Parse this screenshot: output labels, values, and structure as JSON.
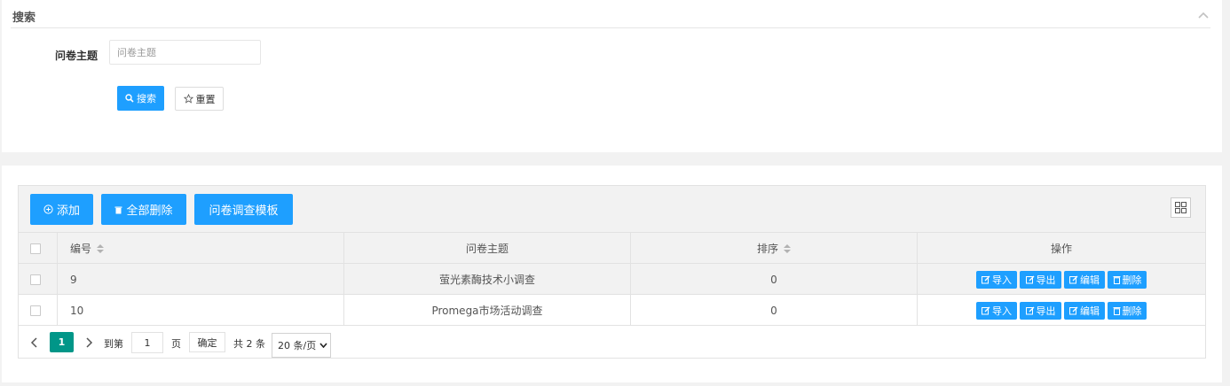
{
  "search": {
    "title": "搜索",
    "field_label": "问卷主题",
    "input_placeholder": "问卷主题",
    "input_value": "",
    "search_label": "搜索",
    "reset_label": "重置"
  },
  "toolbar": {
    "add_label": "添加",
    "delete_all_label": "全部删除",
    "template_label": "问卷调查模板"
  },
  "table": {
    "headers": {
      "id": "编号",
      "topic": "问卷主题",
      "order": "排序",
      "actions": "操作"
    },
    "rows": [
      {
        "id": "9",
        "topic": "萤光素酶技术小调查",
        "order": "0"
      },
      {
        "id": "10",
        "topic": "Promega市场活动调查",
        "order": "0"
      }
    ],
    "row_actions": {
      "import": "导入",
      "export": "导出",
      "edit": "编辑",
      "delete": "删除"
    }
  },
  "pager": {
    "current_page": "1",
    "goto_prefix": "到第",
    "goto_value": "1",
    "goto_suffix": "页",
    "confirm_label": "确定",
    "total_text": "共 2 条",
    "page_size": "20 条/页"
  },
  "colors": {
    "primary": "#1e9fff",
    "pager_active": "#009688",
    "panel_bg": "#f2f2f2"
  }
}
